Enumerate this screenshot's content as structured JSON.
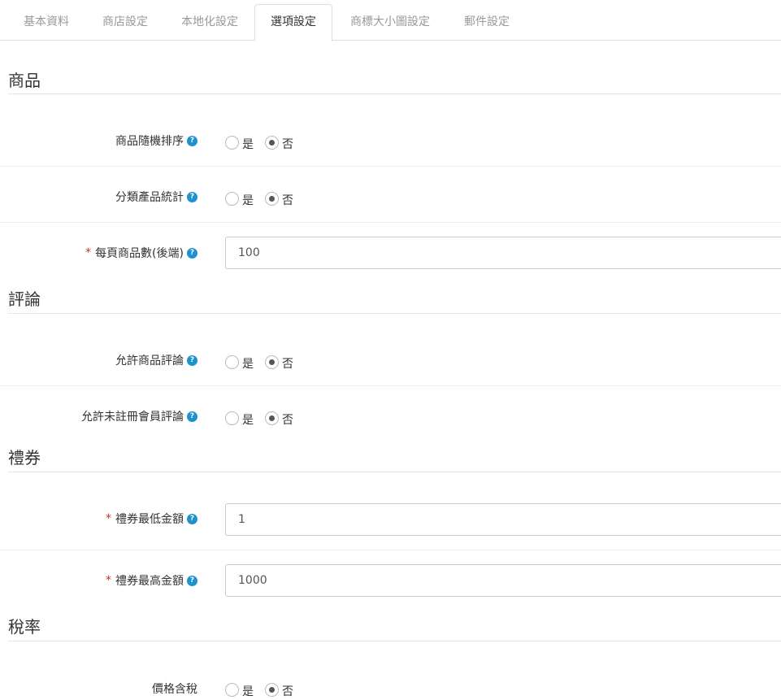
{
  "tabs": [
    {
      "label": "基本資料"
    },
    {
      "label": "商店設定"
    },
    {
      "label": "本地化設定"
    },
    {
      "label": "選項設定",
      "active": true
    },
    {
      "label": "商標大小圖設定"
    },
    {
      "label": "郵件設定"
    }
  ],
  "help_glyph": "?",
  "required_mark": "*",
  "radio_yes": "是",
  "radio_no": "否",
  "sections": {
    "product": {
      "title": "商品",
      "random_sort": {
        "label": "商品隨機排序",
        "value": "否"
      },
      "category_count": {
        "label": "分類產品統計",
        "value": "否"
      },
      "items_per_page_admin": {
        "label": "每頁商品數(後端)",
        "value": "100"
      }
    },
    "review": {
      "title": "評論",
      "allow_reviews": {
        "label": "允許商品評論",
        "value": "否"
      },
      "allow_guest_reviews": {
        "label": "允許未註冊會員評論",
        "value": "否"
      }
    },
    "voucher": {
      "title": "禮券",
      "min_amount": {
        "label": "禮券最低金額",
        "value": "1"
      },
      "max_amount": {
        "label": "禮券最高金額",
        "value": "1000"
      }
    },
    "tax": {
      "title": "稅率",
      "price_with_tax": {
        "label": "價格含稅",
        "value": "否"
      }
    }
  }
}
